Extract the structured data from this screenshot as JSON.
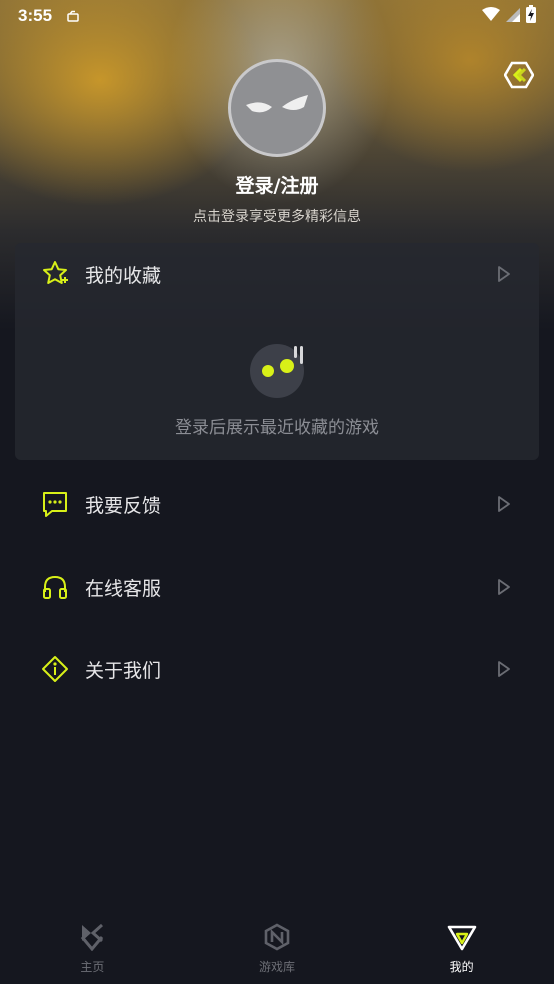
{
  "status_bar": {
    "time": "3:55",
    "icons": [
      "notification-icon",
      "wifi-icon",
      "signal-icon",
      "battery-charging-icon"
    ]
  },
  "header": {
    "settings_icon": "hexagon-settings-icon",
    "login_title": "登录/注册",
    "login_subtitle": "点击登录享受更多精彩信息"
  },
  "favorites": {
    "label": "我的收藏",
    "icon": "star-plus-icon",
    "empty_text": "登录后展示最近收藏的游戏"
  },
  "menu": {
    "feedback_label": "我要反馈",
    "service_label": "在线客服",
    "about_label": "关于我们"
  },
  "tabbar": {
    "home_label": "主页",
    "library_label": "游戏库",
    "mine_label": "我的"
  },
  "colors": {
    "accent": "#d8f018",
    "background": "#15171f",
    "card": "#262830",
    "muted_text": "#8b8d94"
  }
}
